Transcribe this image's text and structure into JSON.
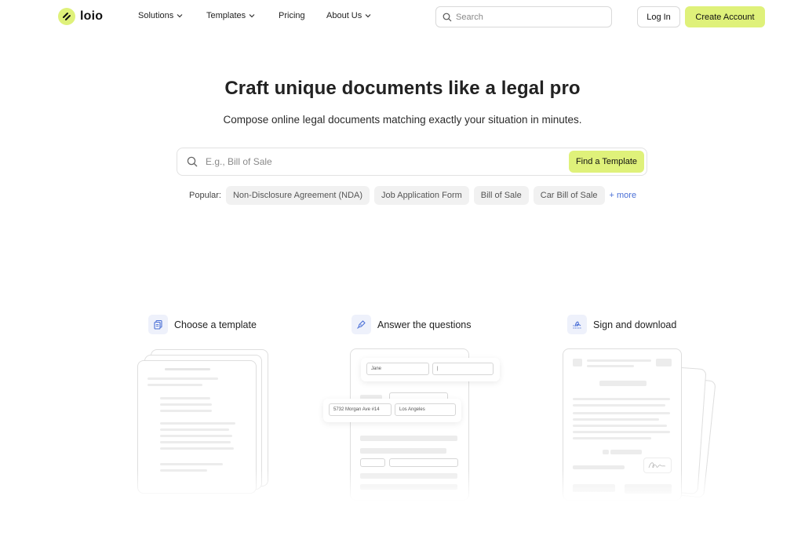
{
  "header": {
    "logo_text": "loio",
    "nav": [
      {
        "label": "Solutions",
        "has_dropdown": true
      },
      {
        "label": "Templates",
        "has_dropdown": true
      },
      {
        "label": "Pricing",
        "has_dropdown": false
      },
      {
        "label": "About Us",
        "has_dropdown": true
      }
    ],
    "search_placeholder": "Search",
    "login_label": "Log In",
    "create_label": "Create Account"
  },
  "hero": {
    "title": "Craft unique documents like a legal pro",
    "subtitle": "Compose online legal documents matching exactly your situation in minutes.",
    "search_placeholder": "E.g., Bill of Sale",
    "find_label": "Find a Template",
    "popular_label": "Popular:",
    "popular_items": [
      "Non-Disclosure Agreement (NDA)",
      "Job Application Form",
      "Bill of Sale",
      "Car Bill of Sale"
    ],
    "more_label": "+ more"
  },
  "steps": [
    {
      "label": "Choose a template",
      "icon": "document-copy-icon"
    },
    {
      "label": "Answer the questions",
      "icon": "pen-icon"
    },
    {
      "label": "Sign and download",
      "icon": "signature-icon"
    }
  ],
  "illustration": {
    "field_name": "Jane",
    "field_address": "5732 Morgan Ave #14",
    "field_city": "Los Angeles"
  },
  "colors": {
    "accent": "#dff17a",
    "link": "#4a6fd6",
    "chip_bg": "#f1f1f1"
  }
}
